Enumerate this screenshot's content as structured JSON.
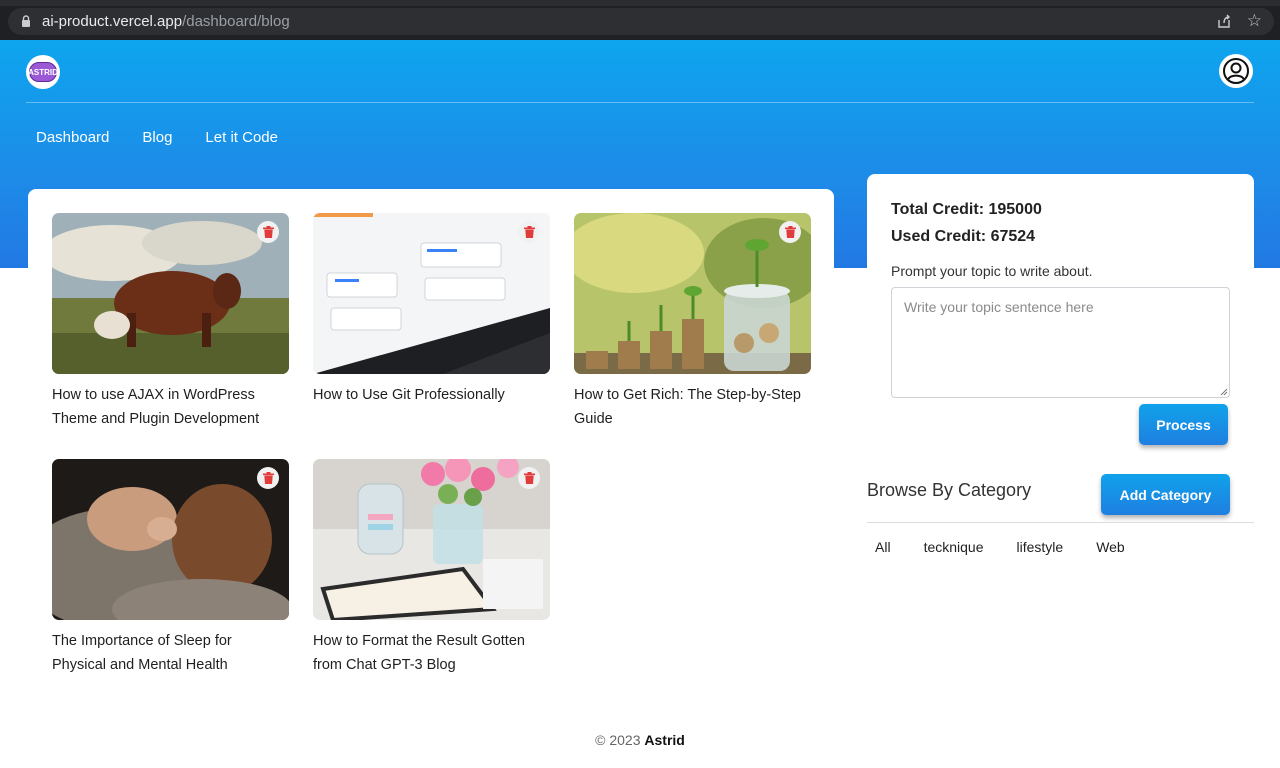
{
  "browser": {
    "url_host": "ai-product.vercel.app",
    "url_path": "/dashboard/blog"
  },
  "header": {
    "logo_text": "ASTRID",
    "nav": [
      "Dashboard",
      "Blog",
      "Let it Code"
    ]
  },
  "posts": [
    {
      "title": "How to use AJAX in WordPress Theme and Plugin Development"
    },
    {
      "title": "How to Use Git Professionally"
    },
    {
      "title": "How to Get Rich: The Step-by-Step Guide"
    },
    {
      "title": "The Importance of Sleep for Physical and Mental Health"
    },
    {
      "title": "How to Format the Result Gotten from Chat GPT-3 Blog"
    }
  ],
  "credits": {
    "total": "Total Credit: 195000",
    "used": "Used Credit: 67524"
  },
  "prompt": {
    "label": "Prompt your topic to write about.",
    "placeholder": "Write your topic sentence here",
    "button": "Process"
  },
  "category": {
    "heading": "Browse By Category",
    "add_button": "Add Category",
    "items": [
      "All",
      "tecknique",
      "lifestyle",
      "Web"
    ]
  },
  "footer": {
    "prefix": "© 2023",
    "brand": "Astrid"
  },
  "colors": {
    "accent": "#1d8be8",
    "delete": "#e23b3b"
  }
}
